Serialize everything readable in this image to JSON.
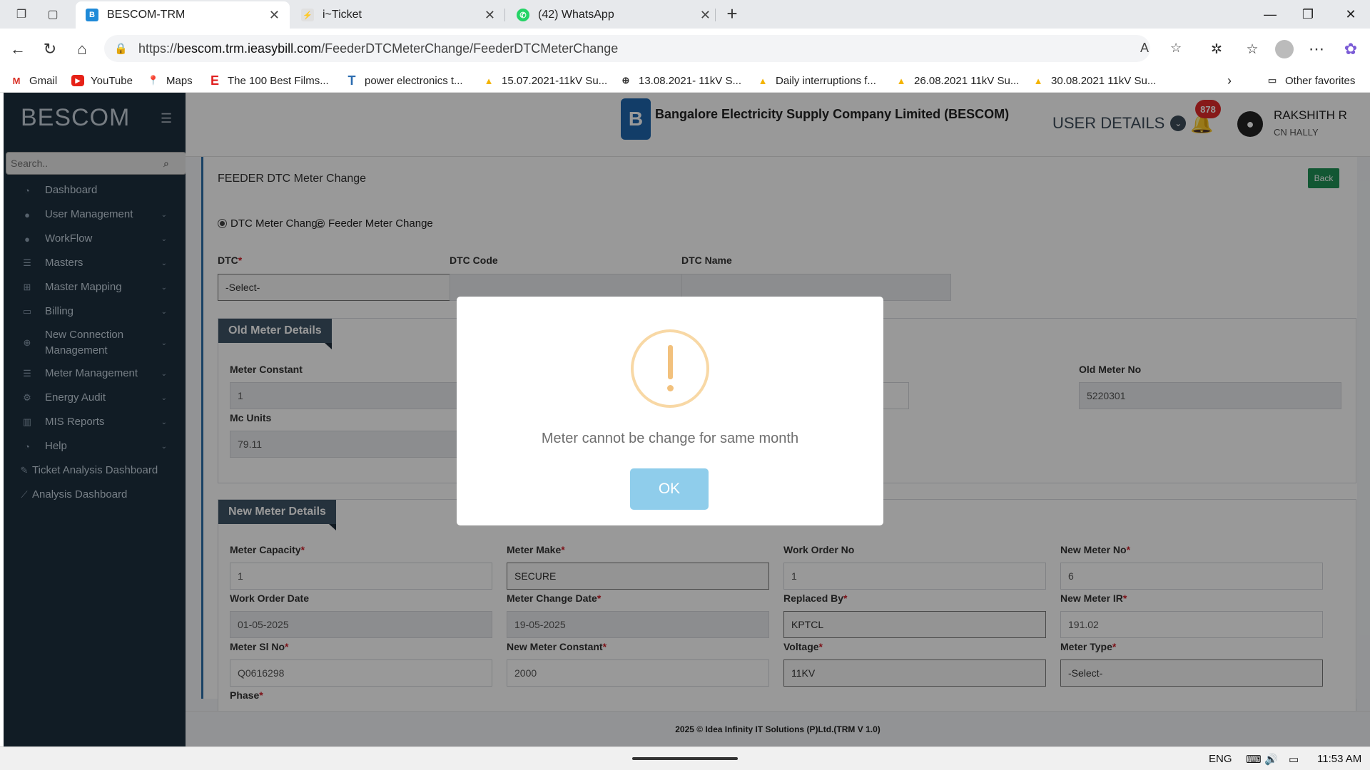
{
  "browser": {
    "tabs": [
      {
        "title": "BESCOM-TRM",
        "active": true
      },
      {
        "title": "i~Ticket",
        "active": false
      },
      {
        "title": "(42) WhatsApp",
        "active": false
      }
    ],
    "url_prefix": "https://",
    "url_host": "bescom.trm.ieasybill.com",
    "url_path": "/FeederDTCMeterChange/FeederDTCMeterChange",
    "bookmarks": [
      {
        "label": "Gmail",
        "icon": "gmail-icon"
      },
      {
        "label": "YouTube",
        "icon": "youtube-icon"
      },
      {
        "label": "Maps",
        "icon": "maps-icon"
      },
      {
        "label": "The 100 Best Films...",
        "icon": "e-icon"
      },
      {
        "label": "power electronics t...",
        "icon": "t-icon"
      },
      {
        "label": "15.07.2021-11kV Su...",
        "icon": "drive-icon"
      },
      {
        "label": "13.08.2021- 11kV S...",
        "icon": "globe-icon"
      },
      {
        "label": "Daily interruptions f...",
        "icon": "drive-icon"
      },
      {
        "label": "26.08.2021 11kV Su...",
        "icon": "drive-icon"
      },
      {
        "label": "30.08.2021 11kV Su...",
        "icon": "drive-icon"
      }
    ],
    "other_favorites": "Other favorites"
  },
  "sidebar": {
    "brand": "BESCOM",
    "search_placeholder": "Search..",
    "items": [
      {
        "label": "Dashboard",
        "icon": "dashboard-icon",
        "has_children": false
      },
      {
        "label": "User Management",
        "icon": "user-icon",
        "has_children": true
      },
      {
        "label": "WorkFlow",
        "icon": "user-icon",
        "has_children": true
      },
      {
        "label": "Masters",
        "icon": "list-icon",
        "has_children": true
      },
      {
        "label": "Master Mapping",
        "icon": "sitemap-icon",
        "has_children": true
      },
      {
        "label": "Billing",
        "icon": "monitor-icon",
        "has_children": true
      },
      {
        "label": "New Connection Management",
        "icon": "plus-circle-icon",
        "has_children": true
      },
      {
        "label": "Meter Management",
        "icon": "list-icon",
        "has_children": true
      },
      {
        "label": "Energy Audit",
        "icon": "gears-icon",
        "has_children": true
      },
      {
        "label": "MIS Reports",
        "icon": "bar-chart-icon",
        "has_children": true
      },
      {
        "label": "Help",
        "icon": "dashboard-icon",
        "has_children": true
      },
      {
        "label": "Ticket Analysis Dashboard",
        "icon": "pencil-icon",
        "has_children": false
      },
      {
        "label": "Analysis Dashboard",
        "icon": "line-chart-icon",
        "has_children": false
      }
    ]
  },
  "header": {
    "logo_text": "B",
    "company": "Bangalore Electricity Supply Company Limited (BESCOM)",
    "user_details": "USER DETAILS",
    "notification_count": "878",
    "user_name": "RAKSHITH R",
    "user_location": "CN HALLY"
  },
  "page": {
    "title": "FEEDER DTC Meter Change",
    "back_label": "Back",
    "radio_dtc": "DTC Meter Change",
    "radio_feeder": "Feeder Meter Change",
    "selected_radio": "dtc",
    "dtc_label": "DTC",
    "dtc_value": "-Select-",
    "dtc_code_label": "DTC Code",
    "dtc_code_value": "",
    "dtc_name_label": "DTC Name",
    "dtc_name_value": "",
    "old_meter": {
      "heading": "Old Meter Details",
      "meter_constant_label": "Meter Constant",
      "meter_constant_value": "1",
      "old_meter_no_label": "Old Meter No",
      "old_meter_no_value": "5220301",
      "mc_units_label": "Mc Units",
      "mc_units_value": "79.11"
    },
    "new_meter": {
      "heading": "New Meter Details",
      "meter_capacity_label": "Meter Capacity",
      "meter_capacity_value": "1",
      "meter_make_label": "Meter Make",
      "meter_make_value": "SECURE",
      "work_order_no_label": "Work Order No",
      "work_order_no_value": "1",
      "new_meter_no_label": "New Meter No",
      "new_meter_no_value": "6",
      "work_order_date_label": "Work Order Date",
      "work_order_date_value": "01-05-2025",
      "meter_change_date_label": "Meter Change Date",
      "meter_change_date_value": "19-05-2025",
      "replaced_by_label": "Replaced By",
      "replaced_by_value": "KPTCL",
      "new_meter_ir_label": "New Meter IR",
      "new_meter_ir_value": "191.02",
      "meter_sl_no_label": "Meter Sl No",
      "meter_sl_no_value": "Q0616298",
      "new_meter_constant_label": "New Meter Constant",
      "new_meter_constant_value": "2000",
      "voltage_label": "Voltage",
      "voltage_value": "11KV",
      "meter_type_label": "Meter Type",
      "meter_type_value": "-Select-",
      "phase_label": "Phase"
    },
    "footer": "2025 © Idea Infinity IT Solutions (P)Ltd.(TRM V 1.0)"
  },
  "modal": {
    "message": "Meter cannot be change for same month",
    "ok_label": "OK"
  },
  "taskbar": {
    "language": "ENG",
    "time": "11:53 AM"
  }
}
